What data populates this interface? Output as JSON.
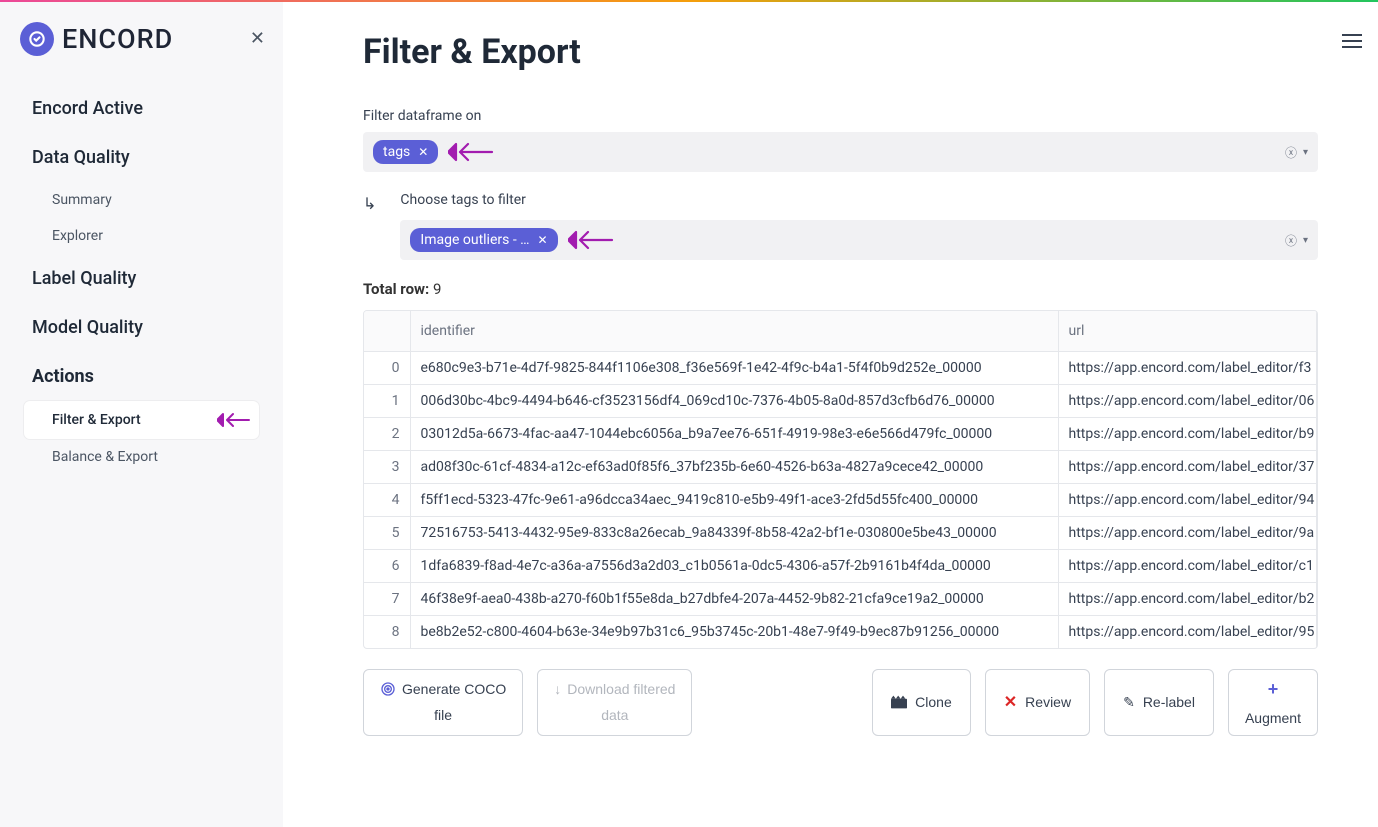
{
  "brand": "ENCORD",
  "sidebar": {
    "items": [
      {
        "label": "Encord Active",
        "type": "top"
      },
      {
        "label": "Data Quality",
        "type": "top"
      },
      {
        "label": "Summary",
        "type": "sub"
      },
      {
        "label": "Explorer",
        "type": "sub"
      },
      {
        "label": "Label Quality",
        "type": "top"
      },
      {
        "label": "Model Quality",
        "type": "top"
      },
      {
        "label": "Actions",
        "type": "top-bold"
      },
      {
        "label": "Filter & Export",
        "type": "sub-active"
      },
      {
        "label": "Balance & Export",
        "type": "sub"
      }
    ]
  },
  "page": {
    "title": "Filter & Export",
    "filterLabel": "Filter dataframe on",
    "filterChip": "tags",
    "chooseLabel": "Choose tags to filter",
    "tagChip": "Image outliers - …",
    "totalLabel": "Total row:",
    "totalValue": "9",
    "downArrow": "↳"
  },
  "table": {
    "headers": {
      "idx": "",
      "identifier": "identifier",
      "url": "url"
    },
    "rows": [
      {
        "i": "0",
        "id": "e680c9e3-b71e-4d7f-9825-844f1106e308_f36e569f-1e42-4f9c-b4a1-5f4f0b9d252e_00000",
        "url": "https://app.encord.com/label_editor/f3"
      },
      {
        "i": "1",
        "id": "006d30bc-4bc9-4494-b646-cf3523156df4_069cd10c-7376-4b05-8a0d-857d3cfb6d76_00000",
        "url": "https://app.encord.com/label_editor/06"
      },
      {
        "i": "2",
        "id": "03012d5a-6673-4fac-aa47-1044ebc6056a_b9a7ee76-651f-4919-98e3-e6e566d479fc_00000",
        "url": "https://app.encord.com/label_editor/b9"
      },
      {
        "i": "3",
        "id": "ad08f30c-61cf-4834-a12c-ef63ad0f85f6_37bf235b-6e60-4526-b63a-4827a9cece42_00000",
        "url": "https://app.encord.com/label_editor/37"
      },
      {
        "i": "4",
        "id": "f5ff1ecd-5323-47fc-9e61-a96dcca34aec_9419c810-e5b9-49f1-ace3-2fd5d55fc400_00000",
        "url": "https://app.encord.com/label_editor/94"
      },
      {
        "i": "5",
        "id": "72516753-5413-4432-95e9-833c8a26ecab_9a84339f-8b58-42a2-bf1e-030800e5be43_00000",
        "url": "https://app.encord.com/label_editor/9a"
      },
      {
        "i": "6",
        "id": "1dfa6839-f8ad-4e7c-a36a-a7556d3a2d03_c1b0561a-0dc5-4306-a57f-2b9161b4f4da_00000",
        "url": "https://app.encord.com/label_editor/c1"
      },
      {
        "i": "7",
        "id": "46f38e9f-aea0-438b-a270-f60b1f55e8da_b27dbfe4-207a-4452-9b82-21cfa9ce19a2_00000",
        "url": "https://app.encord.com/label_editor/b2"
      },
      {
        "i": "8",
        "id": "be8b2e52-c800-4604-b63e-34e9b97b31c6_95b3745c-20b1-48e7-9f49-b9ec87b91256_00000",
        "url": "https://app.encord.com/label_editor/95"
      }
    ]
  },
  "actions": {
    "coco1": "Generate COCO",
    "coco2": "file",
    "dl1": "Download filtered",
    "dl2": "data",
    "clone": "Clone",
    "review": "Review",
    "relabel": "Re-label",
    "augment": "Augment",
    "dlIcon": "↓",
    "plusIcon": "+",
    "reviewIcon": "✕",
    "relabelIcon": "✎"
  },
  "colors": {
    "accent": "#5b5fd6",
    "ptr": "#a21caf"
  }
}
